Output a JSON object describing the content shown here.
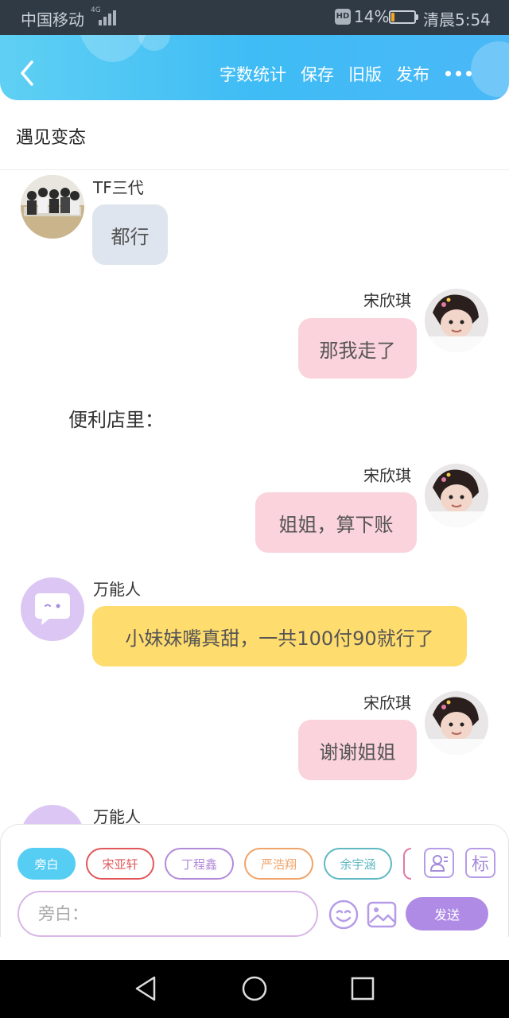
{
  "status_bar": {
    "carrier": "中国移动",
    "network": "4G",
    "hd_badge": "HD",
    "battery_percent": "14%",
    "battery_level": 0.14,
    "time": "清晨5:54"
  },
  "header": {
    "back_icon": "chevron-left-icon",
    "actions": [
      "字数统计",
      "保存",
      "旧版",
      "发布"
    ],
    "more_icon": "more-dots-icon"
  },
  "story": {
    "title": "遇见变态"
  },
  "messages": [
    {
      "speaker": "TF三代",
      "text": "都行",
      "side": "left",
      "bubble_color": "#dfe5ee"
    },
    {
      "speaker": "宋欣琪",
      "text": "那我走了",
      "side": "right",
      "bubble_color": "#fbd3dc"
    },
    {
      "narration": "便利店里："
    },
    {
      "speaker": "宋欣琪",
      "text": "姐姐，算下账",
      "side": "right",
      "bubble_color": "#fbd3dc"
    },
    {
      "speaker": "万能人",
      "text": "小妹妹嘴真甜，一共100付90就行了",
      "side": "left",
      "bubble_color": "#ffdc6e"
    },
    {
      "speaker": "宋欣琪",
      "text": "谢谢姐姐",
      "side": "right",
      "bubble_color": "#fbd3dc"
    },
    {
      "speaker": "万能人",
      "text": "",
      "side": "left"
    }
  ],
  "composer": {
    "roles": [
      {
        "label": "旁白",
        "color": "#56cdf3",
        "active": true
      },
      {
        "label": "宋亚轩",
        "color": "#e0575a",
        "active": false
      },
      {
        "label": "丁程鑫",
        "color": "#b38ad8",
        "active": false
      },
      {
        "label": "严浩翔",
        "color": "#f0a46a",
        "active": false
      },
      {
        "label": "余宇涵",
        "color": "#5fb8c2",
        "active": false
      }
    ],
    "role_manage_icon": "role-card-icon",
    "tag_button_label": "标",
    "input_placeholder": "旁白：",
    "emoji_icon": "emoji-icon",
    "image_icon": "image-icon",
    "send_label": "发送"
  },
  "system_nav": {
    "icons": [
      "back-triangle-icon",
      "home-circle-icon",
      "recents-square-icon"
    ]
  }
}
